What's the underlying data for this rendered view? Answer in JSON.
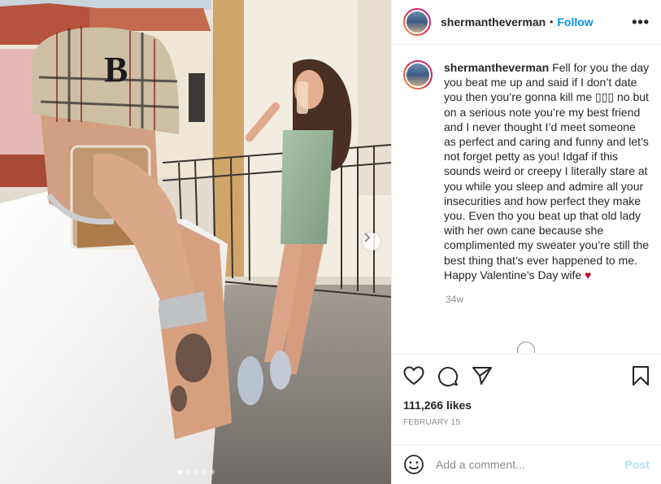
{
  "post": {
    "username": "shermantheverman",
    "bullet": "•",
    "follow_label": "Follow",
    "more_label": "•••",
    "caption": "Fell for you the day you beat me up and said if I don’t date you then you’re gonna kill me ▯▯▯ no but on a serious note you’re my best friend and I never thought I’d meet someone as perfect and caring and funny and let’s not forget petty as you! Idgaf if this sounds weird or creepy I literally stare at you while you sleep and admire all your insecurities and how perfect they make you. Even tho you beat up that old lady with her own cane because she complimented my sweater you’re still the best thing that’s ever happened to me. Happy Valentine’s Day wife",
    "caption_emoji": "♥",
    "time_ago": "34w",
    "likes": "111,266 likes",
    "date": "FEBRUARY 15",
    "carousel": {
      "count": 5,
      "active_index": 0
    }
  },
  "comment_box": {
    "placeholder": "Add a comment...",
    "post_label": "Post"
  },
  "icons": {
    "like": "heart-icon",
    "comment": "comment-bubble-icon",
    "share": "paper-plane-icon",
    "save": "bookmark-icon",
    "emoji": "smiley-icon",
    "next": "chevron-right-icon",
    "more": "ellipsis-icon"
  },
  "colors": {
    "accent": "#0095f6",
    "post_disabled": "#b2dffc",
    "muted": "#8e8e8e",
    "heart_emoji": "#c0001a"
  }
}
